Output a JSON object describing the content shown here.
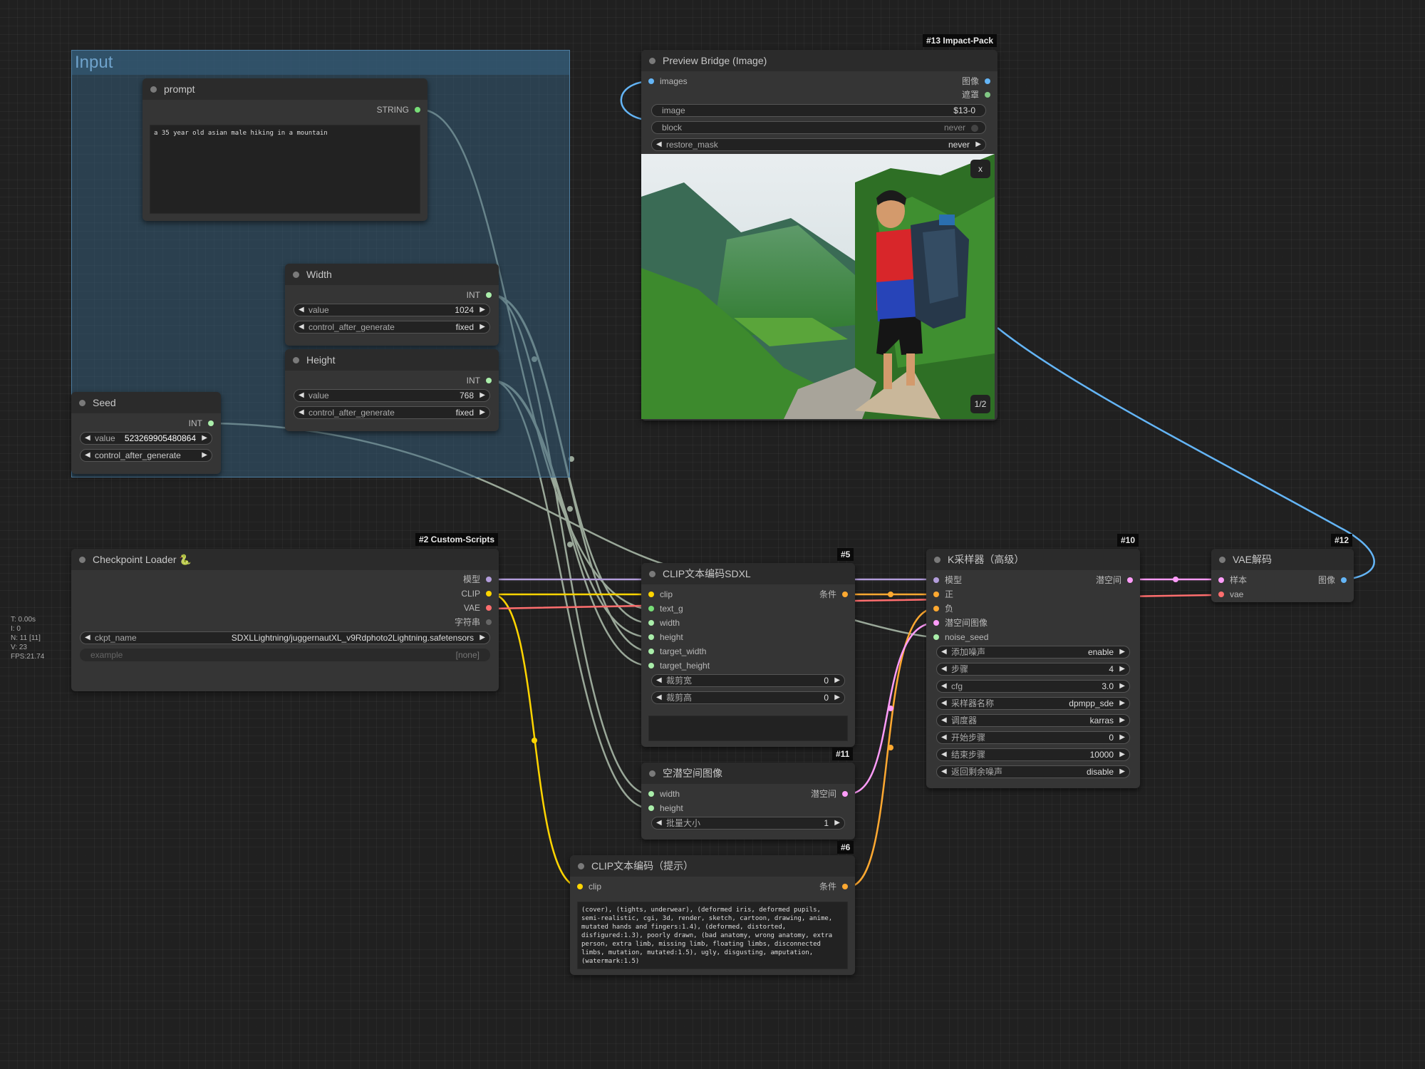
{
  "colors": {
    "model": "#b39ddb",
    "clip": "#ffd500",
    "vae": "#ff6e6e",
    "int": "#aaeeaa",
    "string": "#77dd77",
    "image": "#64b5f6",
    "latent": "#ff9cf9",
    "conditioning": "#ffa931",
    "mask": "#81c784",
    "int_wire": "#9aa899"
  },
  "group": {
    "title": "Input"
  },
  "prompt_node": {
    "title": "prompt",
    "output_label": "STRING",
    "text": "a 35 year old asian male hiking in a mountain"
  },
  "width_node": {
    "title": "Width",
    "output_label": "INT",
    "widgets": [
      {
        "label": "value",
        "value": "1024"
      },
      {
        "label": "control_after_generate",
        "value": "fixed"
      }
    ]
  },
  "height_node": {
    "title": "Height",
    "output_label": "INT",
    "widgets": [
      {
        "label": "value",
        "value": "768"
      },
      {
        "label": "control_after_generate",
        "value": "fixed"
      }
    ]
  },
  "seed_node": {
    "title": "Seed",
    "output_label": "INT",
    "widgets": [
      {
        "label": "value",
        "value": "523269905480864"
      },
      {
        "label": "control_after_generate",
        "value": ""
      }
    ]
  },
  "checkpoint_node": {
    "badge": "#2 Custom-Scripts",
    "title": "Checkpoint Loader 🐍",
    "outputs": [
      "模型",
      "CLIP",
      "VAE",
      "字符串"
    ],
    "widgets": [
      {
        "label": "ckpt_name",
        "value": "SDXLLightning/juggernautXL_v9Rdphoto2Lightning.safetensors"
      },
      {
        "label": "example",
        "value": "[none]"
      }
    ]
  },
  "preview_node": {
    "badge": "#13 Impact-Pack",
    "title": "Preview Bridge (Image)",
    "input_label": "images",
    "outputs": [
      "图像",
      "遮罩"
    ],
    "widgets": [
      {
        "label": "image",
        "value": "$13-0"
      },
      {
        "label": "block",
        "value": "never"
      },
      {
        "label": "restore_mask",
        "value": "never"
      }
    ],
    "close_label": "x",
    "page_label": "1/2"
  },
  "clip_sdxl_node": {
    "badge": "#5",
    "title": "CLIP文本编码SDXL",
    "inputs": [
      "clip",
      "text_g",
      "width",
      "height",
      "target_width",
      "target_height"
    ],
    "output_label": "条件",
    "widgets": [
      {
        "label": "裁剪宽",
        "value": "0"
      },
      {
        "label": "裁剪高",
        "value": "0"
      }
    ]
  },
  "empty_latent_node": {
    "badge": "#11",
    "title": "空潜空间图像",
    "inputs": [
      "width",
      "height"
    ],
    "output_label": "潜空间",
    "widgets": [
      {
        "label": "批量大小",
        "value": "1"
      }
    ]
  },
  "clip_neg_node": {
    "badge": "#6",
    "title": "CLIP文本编码（提示）",
    "input_label": "clip",
    "output_label": "条件",
    "text": "(cover), (tights, underwear), (deformed iris, deformed pupils, semi-realistic, cgi, 3d, render, sketch, cartoon, drawing, anime, mutated hands and fingers:1.4), (deformed, distorted, disfigured:1.3), poorly drawn, (bad anatomy, wrong anatomy, extra person, extra limb, missing limb, floating limbs, disconnected limbs, mutation, mutated:1.5), ugly, disgusting, amputation, (watermark:1.5)"
  },
  "ksampler_node": {
    "badge": "#10",
    "title": "K采样器（高级）",
    "inputs": [
      "模型",
      "正",
      "负",
      "潜空间图像",
      "noise_seed"
    ],
    "output_label": "潜空间",
    "widgets": [
      {
        "label": "添加噪声",
        "value": "enable"
      },
      {
        "label": "步骤",
        "value": "4"
      },
      {
        "label": "cfg",
        "value": "3.0"
      },
      {
        "label": "采样器名称",
        "value": "dpmpp_sde"
      },
      {
        "label": "调度器",
        "value": "karras"
      },
      {
        "label": "开始步骤",
        "value": "0"
      },
      {
        "label": "结束步骤",
        "value": "10000"
      },
      {
        "label": "返回剩余噪声",
        "value": "disable"
      }
    ]
  },
  "vae_node": {
    "badge": "#12",
    "title": "VAE解码",
    "inputs": [
      "样本",
      "vae"
    ],
    "output_label": "图像"
  },
  "stats": [
    "T: 0.00s",
    "I: 0",
    "N: 11 [11]",
    "V: 23",
    "FPS:21.74"
  ]
}
